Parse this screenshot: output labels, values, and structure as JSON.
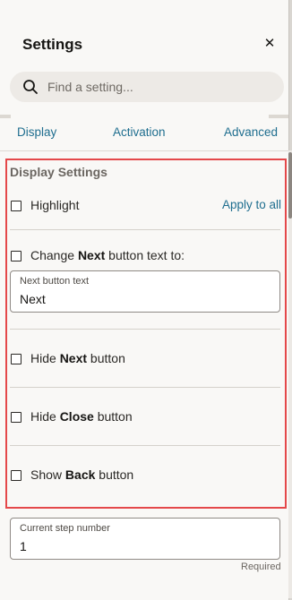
{
  "panel": {
    "title": "Settings",
    "close_icon_char": "✕"
  },
  "search": {
    "placeholder": "Find a setting..."
  },
  "tabs": [
    {
      "label": "Display"
    },
    {
      "label": "Activation"
    },
    {
      "label": "Advanced"
    }
  ],
  "display_settings": {
    "section_title": "Display Settings",
    "highlight_label": "Highlight",
    "apply_to_all": "Apply to all",
    "change_next": {
      "prefix": "Change ",
      "bold": "Next",
      "suffix": " button text to:"
    },
    "next_field": {
      "label": "Next button text",
      "value": "Next"
    },
    "hide_next": {
      "prefix": "Hide ",
      "bold": "Next",
      "suffix": " button"
    },
    "hide_close": {
      "prefix": "Hide ",
      "bold": "Close",
      "suffix": " button"
    },
    "show_back": {
      "prefix": "Show ",
      "bold": "Back",
      "suffix": " button"
    }
  },
  "step_field": {
    "label": "Current step number",
    "value": "1",
    "required_text": "Required"
  },
  "colors": {
    "link": "#1f6e8f",
    "highlight_border": "#e4484a",
    "panel_bg": "#f9f8f6"
  }
}
